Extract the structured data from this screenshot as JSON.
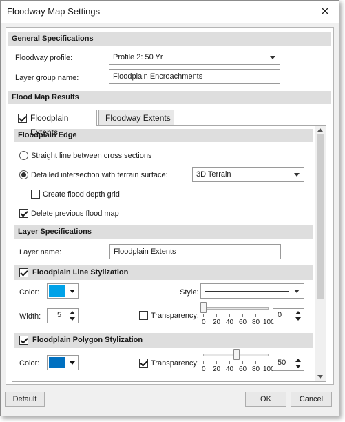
{
  "window": {
    "title": "Floodway Map Settings"
  },
  "general": {
    "header": "General Specifications",
    "profile_label": "Floodway profile:",
    "profile_value": "Profile 2: 50 Yr",
    "layer_group_label": "Layer group name:",
    "layer_group_value": "Floodplain Encroachments"
  },
  "results": {
    "header": "Flood Map Results"
  },
  "tabs": [
    {
      "label": "Floodplain Extents",
      "checked": true,
      "active": true
    },
    {
      "label": "Floodway Extents",
      "active": false
    }
  ],
  "edge": {
    "header": "Floodplain Edge",
    "option_straight": "Straight line between cross sections",
    "option_detailed": "Detailed intersection with terrain surface:",
    "selected": "detailed",
    "terrain_value": "3D Terrain",
    "depth_grid_label": "Create flood depth grid",
    "depth_grid_checked": false,
    "delete_previous_label": "Delete previous flood map",
    "delete_previous_checked": true
  },
  "layer": {
    "header": "Layer Specifications",
    "name_label": "Layer name:",
    "name_value": "Floodplain Extents"
  },
  "line_style": {
    "header": "Floodplain Line Stylization",
    "enabled": true,
    "color_label": "Color:",
    "color": "#00a2e8",
    "style_label": "Style:",
    "width_label": "Width:",
    "width_value": "5",
    "transparency_label": "Transparency:",
    "transparency_checked": false,
    "transparency_value": "0",
    "transparency_level": 0
  },
  "polygon_style": {
    "header": "Floodplain Polygon Stylization",
    "enabled": true,
    "color_label": "Color:",
    "color": "#0070c0",
    "transparency_label": "Transparency:",
    "transparency_checked": true,
    "transparency_value": "50",
    "transparency_level": 50
  },
  "slider_ticks": [
    "0",
    "20",
    "40",
    "60",
    "80",
    "100"
  ],
  "buttons": {
    "default": "Default",
    "ok": "OK",
    "cancel": "Cancel"
  }
}
